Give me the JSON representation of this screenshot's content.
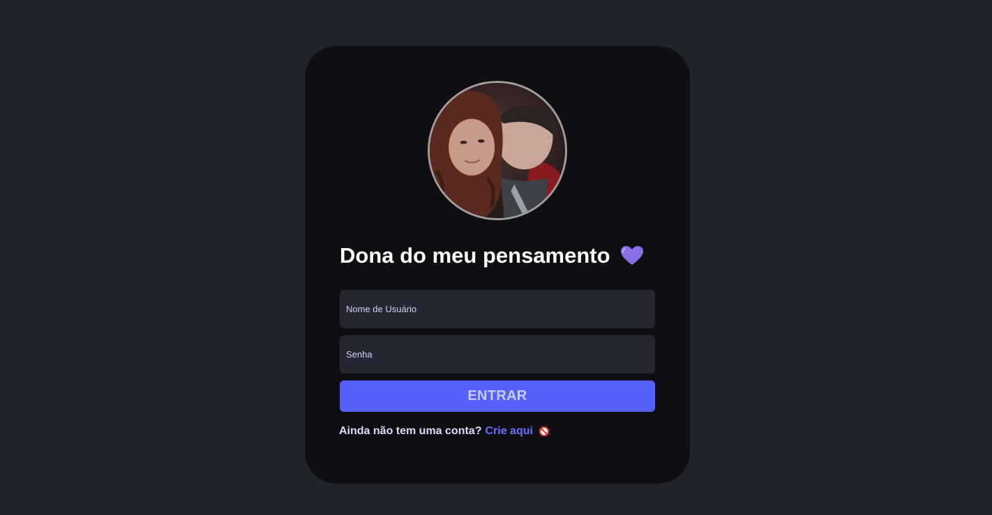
{
  "login": {
    "title": "Dona do meu pensamento",
    "title_icon": "purple-heart-icon",
    "avatar_icon": "couple-photo",
    "username_placeholder": "Nome de Usuário",
    "password_placeholder": "Senha",
    "submit_label": "ENTRAR",
    "signup_question": "Ainda não tem uma conta?",
    "signup_link": "Crie aqui",
    "signup_icon": "no-entry-icon"
  },
  "colors": {
    "background": "#22242c",
    "card": "#0f0f13",
    "input_bg": "#242731",
    "accent": "#5561fb",
    "link": "#6872fb",
    "heart": "#8b6fe8"
  }
}
